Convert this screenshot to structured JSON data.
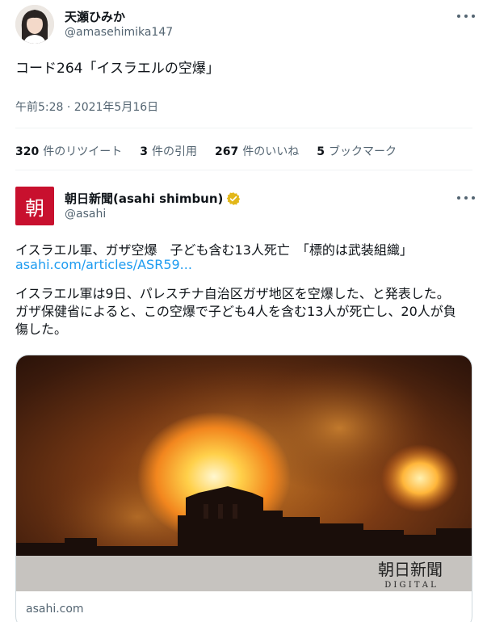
{
  "tweet": {
    "author_name": "天瀬ひみか",
    "author_handle": "@amasehimika147",
    "text": "コード264「イスラエルの空爆」",
    "timestamp": "午前5:28 · 2021年5月16日"
  },
  "stats": {
    "retweets_count": "320",
    "retweets_label": "件のリツイート",
    "quotes_count": "3",
    "quotes_label": "件の引用",
    "likes_count": "267",
    "likes_label": "件のいいね",
    "bookmarks_count": "5",
    "bookmarks_label": "ブックマーク"
  },
  "quoted": {
    "logo_char": "朝",
    "name": "朝日新聞(asahi shimbun)",
    "handle": "@asahi",
    "headline": "イスラエル軍、ガザ空爆　子ども含む13人死亡　「標的は武装組織」",
    "link": "asahi.com/articles/ASR59...",
    "body": "イスラエル軍は9日、パレスチナ自治区ガザ地区を空爆した、と発表した。ガザ保健省によると、この空爆で子ども4人を含む13人が死亡し、20人が負傷した。",
    "card_domain": "asahi.com",
    "card_watermark": "朝日新聞",
    "card_watermark_sub": "D I G I T A L"
  },
  "colors": {
    "link": "#1d9bf0",
    "verified": "#e2b719",
    "asahi_red": "#c8102e",
    "secondary_text": "#536471"
  },
  "icons": {
    "verified": "verified-badge-icon",
    "more": "more-icon"
  }
}
